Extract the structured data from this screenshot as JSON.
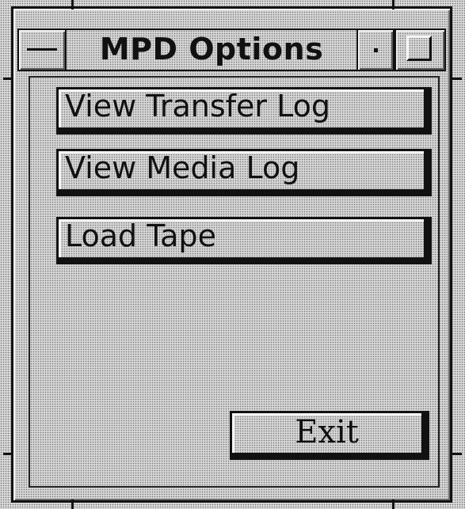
{
  "window": {
    "title": "MPD Options"
  },
  "options": [
    {
      "label": "View Transfer Log"
    },
    {
      "label": "View Media Log"
    },
    {
      "label": "Load Tape"
    }
  ],
  "actions": {
    "exit_label": "Exit"
  },
  "icons": {
    "window_menu": "window-menu-icon",
    "minimize": "minimize-icon",
    "maximize": "maximize-icon"
  },
  "colors": {
    "background": "#d4d4d4",
    "border": "#111111",
    "highlight": "#f4f4f4",
    "shadow": "#5a5a5a"
  }
}
